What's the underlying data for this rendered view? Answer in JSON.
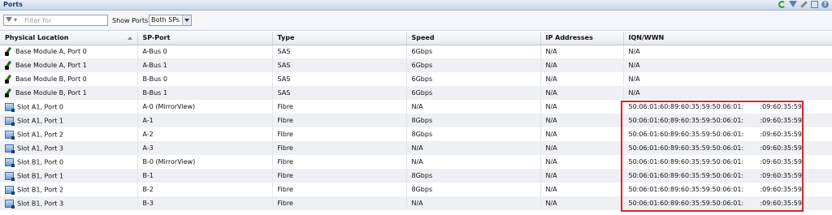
{
  "panel": {
    "title": "Ports"
  },
  "toolbar": {
    "filter_placeholder": "Filter for",
    "show_ports_label": "Show Ports",
    "sp_selected": "Both SPs"
  },
  "table": {
    "columns": [
      "Physical Location",
      "SP-Port",
      "Type",
      "Speed",
      "IP Addresses",
      "IQN/WWN"
    ],
    "rows": [
      {
        "location": "Base Module A, Port 0",
        "sp_port": "A-Bus 0",
        "type": "SAS",
        "speed": "6Gbps",
        "ip": "N/A",
        "wwn": "N/A",
        "icon": "sas-port-icon"
      },
      {
        "location": "Base Module A, Port 1",
        "sp_port": "A-Bus 1",
        "type": "SAS",
        "speed": "6Gbps",
        "ip": "N/A",
        "wwn": "N/A",
        "icon": "sas-port-icon"
      },
      {
        "location": "Base Module B, Port 0",
        "sp_port": "B-Bus 0",
        "type": "SAS",
        "speed": "6Gbps",
        "ip": "N/A",
        "wwn": "N/A",
        "icon": "sas-port-icon"
      },
      {
        "location": "Base Module B, Port 1",
        "sp_port": "B-Bus 1",
        "type": "SAS",
        "speed": "6Gbps",
        "ip": "N/A",
        "wwn": "N/A",
        "icon": "sas-port-icon"
      },
      {
        "location": "Slot A1, Port 0",
        "sp_port": "A-0 (MirrorView)",
        "type": "Fibre",
        "speed": "N/A",
        "ip": "N/A",
        "wwn": "50:06:01:60:89:60:35:59:50:06:01:        :09:60:35:59",
        "icon": "fibre-port-icon"
      },
      {
        "location": "Slot A1, Port 1",
        "sp_port": "A-1",
        "type": "Fibre",
        "speed": "8Gbps",
        "ip": "N/A",
        "wwn": "50:06:01:60:89:60:35:59:50:06:01:        :09:60:35:59",
        "icon": "fibre-port-icon"
      },
      {
        "location": "Slot A1, Port 2",
        "sp_port": "A-2",
        "type": "Fibre",
        "speed": "8Gbps",
        "ip": "N/A",
        "wwn": "50:06:01:60:89:60:35:59:50:06:01:        :09:60:35:59",
        "icon": "fibre-port-icon"
      },
      {
        "location": "Slot A1, Port 3",
        "sp_port": "A-3",
        "type": "Fibre",
        "speed": "N/A",
        "ip": "N/A",
        "wwn": "50:06:01:60:89:60:35:59:50:06:01:        :09:60:35:59",
        "icon": "fibre-port-icon"
      },
      {
        "location": "Slot B1, Port 0",
        "sp_port": "B-0 (MirrorView)",
        "type": "Fibre",
        "speed": "N/A",
        "ip": "N/A",
        "wwn": "50:06:01:60:89:60:35:59:50:06:01:        :09:60:35:59",
        "icon": "fibre-port-icon"
      },
      {
        "location": "Slot B1, Port 1",
        "sp_port": "B-1",
        "type": "Fibre",
        "speed": "8Gbps",
        "ip": "N/A",
        "wwn": "50:06:01:60:89:60:35:59:50:06:01:        :09:60:35:59",
        "icon": "fibre-port-icon"
      },
      {
        "location": "Slot B1, Port 2",
        "sp_port": "B-2",
        "type": "Fibre",
        "speed": "8Gbps",
        "ip": "N/A",
        "wwn": "50:06:01:60:89:60:35:59:50:06:01:        :09:60:35:59",
        "icon": "fibre-port-icon"
      },
      {
        "location": "Slot B1, Port 3",
        "sp_port": "B-3",
        "type": "Fibre",
        "speed": "N/A",
        "ip": "N/A",
        "wwn": "50:06:01:60:89:60:35:59:50:06:01:        :09:60:35:59",
        "icon": "fibre-port-icon"
      }
    ]
  },
  "colors": {
    "highlight": "#d9262b",
    "row_alt": "#eef0f3"
  }
}
